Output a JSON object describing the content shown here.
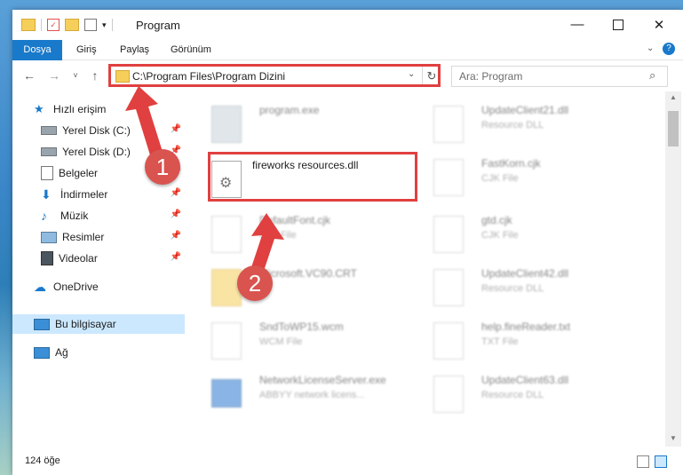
{
  "window": {
    "title": "Program"
  },
  "ribbon": {
    "tabs": [
      "Dosya",
      "Giriş",
      "Paylaş",
      "Görünüm"
    ]
  },
  "address": {
    "path": "C:\\Program Files\\Program Dizini",
    "search_placeholder": "Ara: Program"
  },
  "sidebar": {
    "items": [
      {
        "label": "Hızlı erişim",
        "icon": "star-icon"
      },
      {
        "label": "Yerel Disk (C:)",
        "icon": "drive-icon"
      },
      {
        "label": "Yerel Disk (D:)",
        "icon": "drive-icon"
      },
      {
        "label": "Belgeler",
        "icon": "documents-icon"
      },
      {
        "label": "İndirmeler",
        "icon": "download-icon"
      },
      {
        "label": "Müzik",
        "icon": "music-icon"
      },
      {
        "label": "Resimler",
        "icon": "pictures-icon"
      },
      {
        "label": "Videolar",
        "icon": "videos-icon"
      },
      {
        "label": "OneDrive",
        "icon": "cloud-icon"
      },
      {
        "label": "Bu bilgisayar",
        "icon": "computer-icon"
      },
      {
        "label": "Ağ",
        "icon": "network-icon"
      }
    ]
  },
  "files": {
    "left": [
      {
        "name": "program.exe",
        "type": ""
      },
      {
        "name": "fireworks resources.dll",
        "type": ""
      },
      {
        "name": "DefaultFont.cjk",
        "type": "CJK File"
      },
      {
        "name": "Microsoft.VC90.CRT",
        "type": ""
      },
      {
        "name": "SndToWP15.wcm",
        "type": "WCM File"
      },
      {
        "name": "NetworkLicenseServer.exe",
        "type": "ABBYY network licens..."
      }
    ],
    "right": [
      {
        "name": "UpdateClient21.dll",
        "type": "Resource DLL"
      },
      {
        "name": "FastKorn.cjk",
        "type": "CJK File"
      },
      {
        "name": "gtd.cjk",
        "type": "CJK File"
      },
      {
        "name": "UpdateClient42.dll",
        "type": "Resource DLL"
      },
      {
        "name": "help.fineReader.txt",
        "type": "TXT File"
      },
      {
        "name": "UpdateClient63.dll",
        "type": "Resource DLL"
      }
    ]
  },
  "status": {
    "count": "124 öğe"
  },
  "annotations": {
    "step1": "1",
    "step2": "2"
  },
  "colors": {
    "accent": "#1979ca",
    "highlight": "#e04040",
    "selected": "#cce8ff"
  }
}
